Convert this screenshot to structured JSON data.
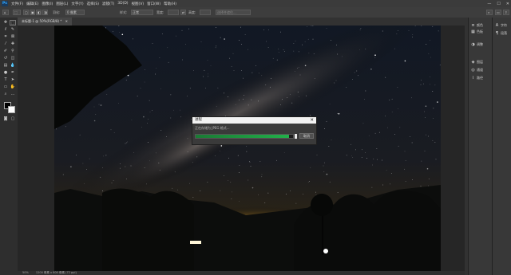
{
  "app": {
    "logo": "Ps"
  },
  "menu": [
    "文件(F)",
    "编辑(E)",
    "图像(I)",
    "图层(L)",
    "文字(Y)",
    "选择(S)",
    "滤镜(T)",
    "3D(D)",
    "视图(V)",
    "窗口(W)",
    "帮助(H)"
  ],
  "window_controls": {
    "minimize": "—",
    "maximize": "☐",
    "close": "✕"
  },
  "options_bar": {
    "feather_label": "羽化:",
    "feather_value": "0 像素",
    "style_label": "样式:",
    "style_value": "正常",
    "width_label": "宽度:",
    "height_label": "高度:",
    "select_mask": "选择并遮住..."
  },
  "document_tab": {
    "title": "未标题-1 @ 50%(RGB/8) *",
    "close": "✕"
  },
  "status_bar": {
    "zoom": "50%",
    "info": "1200 像素 x 800 像素 (72 ppi)"
  },
  "dialog": {
    "title": "进程",
    "close": "✕",
    "message": "正在存储为 JPEG 格式...",
    "progress": 0.96,
    "cancel_label": "取消"
  },
  "panels_right1": [
    {
      "icon": "≡",
      "label": "颜色"
    },
    {
      "icon": "▦",
      "label": "色板"
    },
    {
      "icon": "◑",
      "label": "调整"
    },
    {
      "icon": "◈",
      "label": "图层"
    },
    {
      "icon": "◎",
      "label": "通道"
    },
    {
      "icon": "⌇",
      "label": "路径"
    }
  ],
  "panels_right2": [
    {
      "icon": "A",
      "label": "字符"
    },
    {
      "icon": "¶",
      "label": "段落"
    }
  ],
  "colors": {
    "progress": "#22b04a",
    "accent": "#31a8ff"
  }
}
